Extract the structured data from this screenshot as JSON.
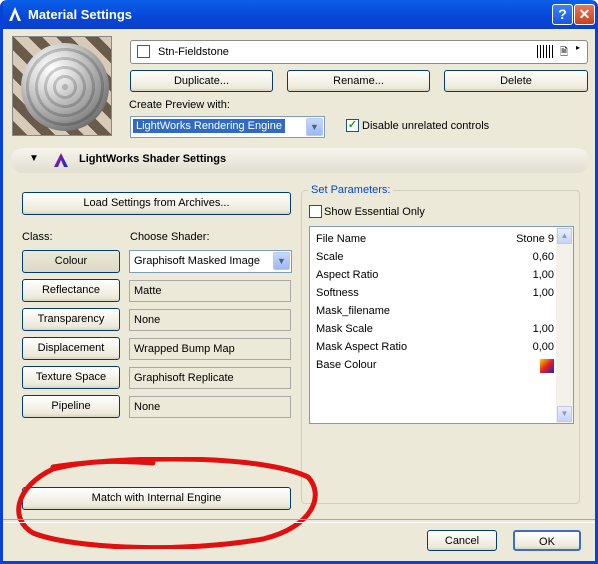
{
  "window": {
    "title": "Material Settings",
    "help_glyph": "?",
    "close_glyph": "✕"
  },
  "material": {
    "name": "Stn-Fieldstone",
    "page_glyph": "🗎",
    "menu_glyph": "▸"
  },
  "buttons": {
    "duplicate": "Duplicate...",
    "rename": "Rename...",
    "delete": "Delete",
    "load_settings": "Load Settings from Archives...",
    "match_engine": "Match with Internal Engine",
    "cancel": "Cancel",
    "ok": "OK"
  },
  "preview": {
    "label": "Create Preview with:",
    "engine": "LightWorks Rendering Engine",
    "disable_label": "Disable unrelated controls",
    "disable_checked": true
  },
  "shader_section": {
    "caret": "▼",
    "title": "LightWorks Shader Settings"
  },
  "class_label": "Class:",
  "shader_label": "Choose Shader:",
  "classes": [
    {
      "name": "Colour",
      "shader": "Graphisoft Masked Image"
    },
    {
      "name": "Reflectance",
      "shader": "Matte"
    },
    {
      "name": "Transparency",
      "shader": "None"
    },
    {
      "name": "Displacement",
      "shader": "Wrapped Bump Map"
    },
    {
      "name": "Texture Space",
      "shader": "Graphisoft Replicate"
    },
    {
      "name": "Pipeline",
      "shader": "None"
    }
  ],
  "set_parameters": {
    "title": "Set Parameters:",
    "essential_label": "Show Essential Only",
    "essential_checked": false,
    "rows": [
      {
        "key": "File Name",
        "value": "Stone 9"
      },
      {
        "key": "Scale",
        "value": "0,60"
      },
      {
        "key": "Aspect Ratio",
        "value": "1,00"
      },
      {
        "key": "Softness",
        "value": "1,00"
      },
      {
        "key": "Mask_filename",
        "value": ""
      },
      {
        "key": "Mask Scale",
        "value": "1,00"
      },
      {
        "key": "Mask Aspect Ratio",
        "value": "0,00"
      },
      {
        "key": "Base Colour",
        "value": ""
      }
    ]
  },
  "colors": {
    "titlebar": "#0848d8",
    "dialog_bg": "#ece9d8",
    "selection": "#316ac5",
    "annotation_circle": "#e01010",
    "group_title": "#0046d5"
  }
}
